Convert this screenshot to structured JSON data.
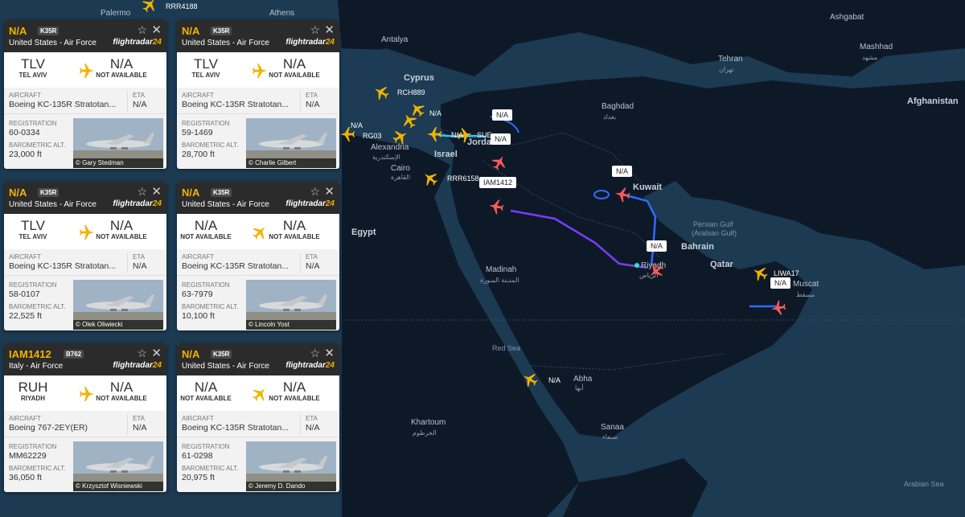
{
  "cards": [
    {
      "callsign": "N/A",
      "type": "K35R",
      "operator": "United States - Air Force",
      "brand_a": "flightradar",
      "brand_b": "24",
      "from_code": "TLV",
      "from_name": "TEL AVIV",
      "to_code": "N/A",
      "to_name": "NOT AVAILABLE",
      "aircraft_label": "AIRCRAFT",
      "aircraft": "Boeing KC-135R Stratotan...",
      "eta_label": "ETA",
      "eta": "N/A",
      "reg_label": "REGISTRATION",
      "registration": "60-0334",
      "alt_label": "BAROMETRIC ALT.",
      "altitude": "23,000 ft",
      "credit": "© Gary Stedman"
    },
    {
      "callsign": "N/A",
      "type": "K35R",
      "operator": "United States - Air Force",
      "brand_a": "flightradar",
      "brand_b": "24",
      "from_code": "TLV",
      "from_name": "TEL AVIV",
      "to_code": "N/A",
      "to_name": "NOT AVAILABLE",
      "aircraft_label": "AIRCRAFT",
      "aircraft": "Boeing KC-135R Stratotan...",
      "eta_label": "ETA",
      "eta": "N/A",
      "reg_label": "REGISTRATION",
      "registration": "59-1469",
      "alt_label": "BAROMETRIC ALT.",
      "altitude": "28,700 ft",
      "credit": "© Charlie Gilbert"
    },
    {
      "callsign": "N/A",
      "type": "K35R",
      "operator": "United States - Air Force",
      "brand_a": "flightradar",
      "brand_b": "24",
      "from_code": "TLV",
      "from_name": "TEL AVIV",
      "to_code": "N/A",
      "to_name": "NOT AVAILABLE",
      "aircraft_label": "AIRCRAFT",
      "aircraft": "Boeing KC-135R Stratotan...",
      "eta_label": "ETA",
      "eta": "N/A",
      "reg_label": "REGISTRATION",
      "registration": "58-0107",
      "alt_label": "BAROMETRIC ALT.",
      "altitude": "22,525 ft",
      "credit": "© Olek Oliwiecki"
    },
    {
      "callsign": "N/A",
      "type": "K35R",
      "operator": "United States - Air Force",
      "brand_a": "flightradar",
      "brand_b": "24",
      "from_code": "N/A",
      "from_name": "NOT AVAILABLE",
      "to_code": "N/A",
      "to_name": "NOT AVAILABLE",
      "aircraft_label": "AIRCRAFT",
      "aircraft": "Boeing KC-135R Stratotan...",
      "eta_label": "ETA",
      "eta": "N/A",
      "reg_label": "REGISTRATION",
      "registration": "63-7979",
      "alt_label": "BAROMETRIC ALT.",
      "altitude": "10,100 ft",
      "credit": "© Lincoln Yost"
    },
    {
      "callsign": "IAM1412",
      "type": "B762",
      "operator": "Italy - Air Force",
      "brand_a": "flightradar",
      "brand_b": "24",
      "from_code": "RUH",
      "from_name": "RIYADH",
      "to_code": "N/A",
      "to_name": "NOT AVAILABLE",
      "aircraft_label": "AIRCRAFT",
      "aircraft": "Boeing 767-2EY(ER)",
      "eta_label": "ETA",
      "eta": "N/A",
      "reg_label": "REGISTRATION",
      "registration": "MM62229",
      "alt_label": "BAROMETRIC ALT.",
      "altitude": "36,050 ft",
      "credit": "© Krzysztof Wisniewski"
    },
    {
      "callsign": "N/A",
      "type": "K35R",
      "operator": "United States - Air Force",
      "brand_a": "flightradar",
      "brand_b": "24",
      "from_code": "N/A",
      "from_name": "NOT AVAILABLE",
      "to_code": "N/A",
      "to_name": "NOT AVAILABLE",
      "aircraft_label": "AIRCRAFT",
      "aircraft": "Boeing KC-135R Stratotan...",
      "eta_label": "ETA",
      "eta": "N/A",
      "reg_label": "REGISTRATION",
      "registration": "61-0298",
      "alt_label": "BAROMETRIC ALT.",
      "altitude": "20,975 ft",
      "credit": "© Jeremy D. Dando"
    }
  ],
  "map": {
    "places": [
      {
        "id": "palermo",
        "text": "Palermo"
      },
      {
        "id": "athens",
        "text": "Athens"
      },
      {
        "id": "antalya",
        "text": "Antalya"
      },
      {
        "id": "cyprus",
        "text": "Cyprus"
      },
      {
        "id": "alexandria",
        "text": "Alexandria"
      },
      {
        "id": "alexandria-ar",
        "text": "الإسكندرية"
      },
      {
        "id": "cairo",
        "text": "Cairo"
      },
      {
        "id": "cairo-ar",
        "text": "القاهرة"
      },
      {
        "id": "egypt",
        "text": "Egypt"
      },
      {
        "id": "israel",
        "text": "Israel"
      },
      {
        "id": "jordan",
        "text": "Jordan"
      },
      {
        "id": "baghdad",
        "text": "Baghdad"
      },
      {
        "id": "baghdad-ar",
        "text": "بغداد"
      },
      {
        "id": "tehran",
        "text": "Tehran"
      },
      {
        "id": "tehran-ar",
        "text": "تهران"
      },
      {
        "id": "ashgabat",
        "text": "Ashgabat"
      },
      {
        "id": "mashhad",
        "text": "Mashhad"
      },
      {
        "id": "mashhad-ar",
        "text": "مشهد"
      },
      {
        "id": "afghanistan",
        "text": "Afghanistan"
      },
      {
        "id": "kuwait",
        "text": "Kuwait"
      },
      {
        "id": "persian-gulf",
        "text": "Persian Gulf"
      },
      {
        "id": "arabian-gulf",
        "text": "(Arabian Gulf)"
      },
      {
        "id": "bahrain",
        "text": "Bahrain"
      },
      {
        "id": "qatar",
        "text": "Qatar"
      },
      {
        "id": "riyadh",
        "text": "Riyadh"
      },
      {
        "id": "riyadh-ar",
        "text": "الرياض"
      },
      {
        "id": "muscat",
        "text": "Muscat"
      },
      {
        "id": "muscat-ar",
        "text": "مسقط"
      },
      {
        "id": "madinah",
        "text": "Madinah"
      },
      {
        "id": "madinah-ar",
        "text": "المدينة المنورة"
      },
      {
        "id": "red-sea",
        "text": "Red Sea"
      },
      {
        "id": "abha",
        "text": "Abha"
      },
      {
        "id": "abha-ar",
        "text": "أبها"
      },
      {
        "id": "sanaa",
        "text": "Sanaa"
      },
      {
        "id": "sanaa-ar",
        "text": "صنعاء"
      },
      {
        "id": "khartoum",
        "text": "Khartoum"
      },
      {
        "id": "khartoum-ar",
        "text": "الخرطوم"
      },
      {
        "id": "arabian-sea",
        "text": "Arabian Sea"
      }
    ],
    "aircraft_labels": [
      {
        "id": "rrr4188",
        "text": "RRR4188"
      },
      {
        "id": "rch889",
        "text": "RCH889"
      },
      {
        "id": "rg03",
        "text": "RG03"
      },
      {
        "id": "na-west",
        "text": "N/A"
      },
      {
        "id": "na-cyprus",
        "text": "N/A"
      },
      {
        "id": "na-sub",
        "text": "N/A"
      },
      {
        "id": "sub",
        "text": "SUE"
      },
      {
        "id": "rrr6158",
        "text": "RRR6158"
      },
      {
        "id": "na-abha",
        "text": "N/A"
      }
    ],
    "tags": [
      {
        "id": "tag1",
        "text": "N/A"
      },
      {
        "id": "tag2",
        "text": "N/A"
      },
      {
        "id": "tag-iam1412",
        "text": "IAM1412"
      },
      {
        "id": "tag-kuwait",
        "text": "N/A"
      },
      {
        "id": "tag-riyadh",
        "text": "N/A"
      },
      {
        "id": "tag-oman",
        "text": "N/A"
      },
      {
        "id": "tag-liwa17",
        "text": "LIWA17"
      }
    ]
  },
  "colors": {
    "land": "#0f1a2a",
    "sea": "#1c3a52",
    "accent": "#f2b300",
    "selected": "#ff4d4d",
    "track_blue": "#2f6bff",
    "track_purple": "#7a3cff"
  }
}
